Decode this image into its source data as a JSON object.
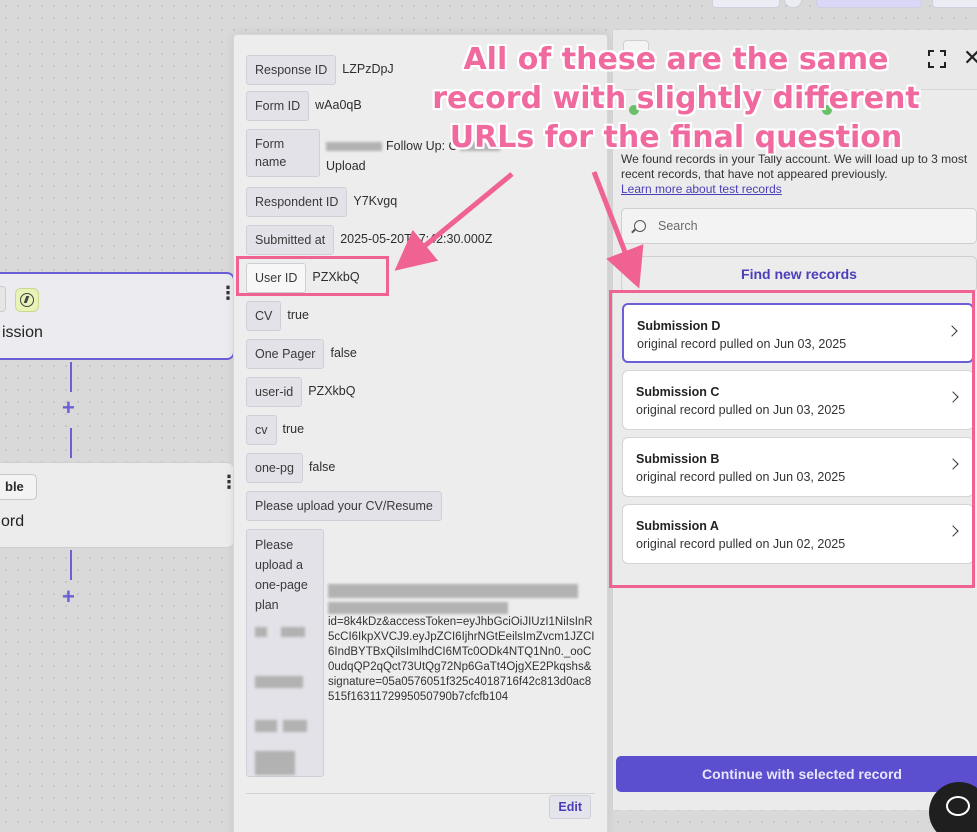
{
  "canvas": {
    "node1": {
      "title": "ission"
    },
    "node2": {
      "button_label": "ble",
      "title": "ord"
    },
    "plus_symbol": "+",
    "kebab_symbol": "⋮"
  },
  "record_panel": {
    "fields": [
      {
        "key": "Response ID",
        "value": "LZPzDpJ"
      },
      {
        "key": "Form ID",
        "value": "wAa0qB"
      },
      {
        "key": "Form name",
        "value": "Follow Up: C",
        "value2": "Upload"
      },
      {
        "key": "Respondent ID",
        "value": "Y7Kvgq"
      },
      {
        "key": "Submitted at",
        "value": "2025-05-20T17:42:30.000Z"
      },
      {
        "key": "User ID",
        "value": "PZXkbQ"
      },
      {
        "key": "CV",
        "value": "true"
      },
      {
        "key": "One Pager",
        "value": "false"
      },
      {
        "key": "user-id",
        "value": "PZXkbQ"
      },
      {
        "key": "cv",
        "value": "true"
      },
      {
        "key": "one-pg",
        "value": "false"
      },
      {
        "key": "Please upload your CV/Resume",
        "value": ""
      },
      {
        "key": "Please upload a one-page plan",
        "value": ""
      }
    ],
    "url_value": "id=8k4kDz&accessToken=eyJhbGciOiJIUzI1NiIsInR5cCI6IkpXVCJ9.eyJpZCI6IjhrNGtEeilsImZvcm1JZCI6IndBYTBxQilsImlhdCI6MTc0ODk4NTQ1Nn0._ooC0udqQP2qQct73UtQg72Np6GaTt4OjgXE2Pkqshs&signature=05a0576051f325c4018716f42c813d0ac8515f1631172995050790b7cfcfb104",
    "edit_label": "Edit"
  },
  "right_panel": {
    "description": "We found records in your Tally account. We will load up to 3 most recent records, that have not appeared previously.",
    "learn_more": "Learn more about test records",
    "search_placeholder": "Search",
    "find_button": "Find new records",
    "records": [
      {
        "title": "Submission D",
        "subtitle": "original record pulled on Jun 03, 2025",
        "selected": true
      },
      {
        "title": "Submission C",
        "subtitle": "original record pulled on Jun 03, 2025",
        "selected": false
      },
      {
        "title": "Submission B",
        "subtitle": "original record pulled on Jun 03, 2025",
        "selected": false
      },
      {
        "title": "Submission A",
        "subtitle": "original record pulled on Jun 02, 2025",
        "selected": false
      }
    ],
    "continue_button": "Continue with selected record",
    "close_symbol": "✕"
  },
  "annotation": {
    "text": "All of these are the same record with slightly different URLs for the final question",
    "color": "#f06292"
  }
}
